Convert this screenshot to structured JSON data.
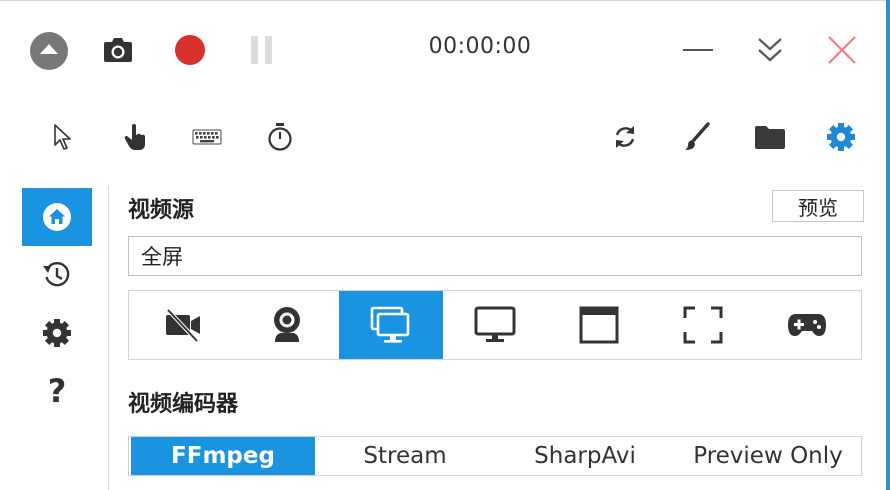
{
  "titlebar": {
    "timer": "00:00:00",
    "buttons": [
      {
        "name": "collapse-button",
        "icon": "eject-up-icon"
      },
      {
        "name": "screenshot-button",
        "icon": "camera-icon"
      },
      {
        "name": "record-button",
        "icon": "record-dot-icon"
      },
      {
        "name": "pause-button",
        "icon": "pause-icon"
      },
      {
        "name": "minimize-button",
        "icon": "minimize-icon"
      },
      {
        "name": "shrink-button",
        "icon": "double-chevron-down-icon"
      },
      {
        "name": "close-button",
        "icon": "close-icon"
      }
    ]
  },
  "toolbar": {
    "tools": [
      "cursor-icon",
      "hand-click-icon",
      "keyboard-icon",
      "stopwatch-icon",
      "refresh-icon",
      "brush-icon",
      "folder-icon",
      "settings-gear-icon"
    ]
  },
  "sidebar": {
    "items": [
      "home-icon",
      "history-icon",
      "gear-icon",
      "help-icon"
    ],
    "help_label": "?"
  },
  "main": {
    "video_source_label": "视频源",
    "preview_label": "预览",
    "source_value": "全屏",
    "sources": [
      "no-video-icon",
      "webcam-icon",
      "screens-icon",
      "monitor-icon",
      "window-icon",
      "region-icon",
      "gamepad-icon"
    ],
    "active_source": "screens-icon",
    "video_encoder_label": "视频编码器",
    "encoders": [
      "FFmpeg",
      "Stream",
      "SharpAvi",
      "Preview Only"
    ],
    "active_encoder": "FFmpeg"
  },
  "colors": {
    "accent": "#1a93e0",
    "record": "#d9302c",
    "close": "#f08080",
    "settings": "#1e88d6"
  }
}
